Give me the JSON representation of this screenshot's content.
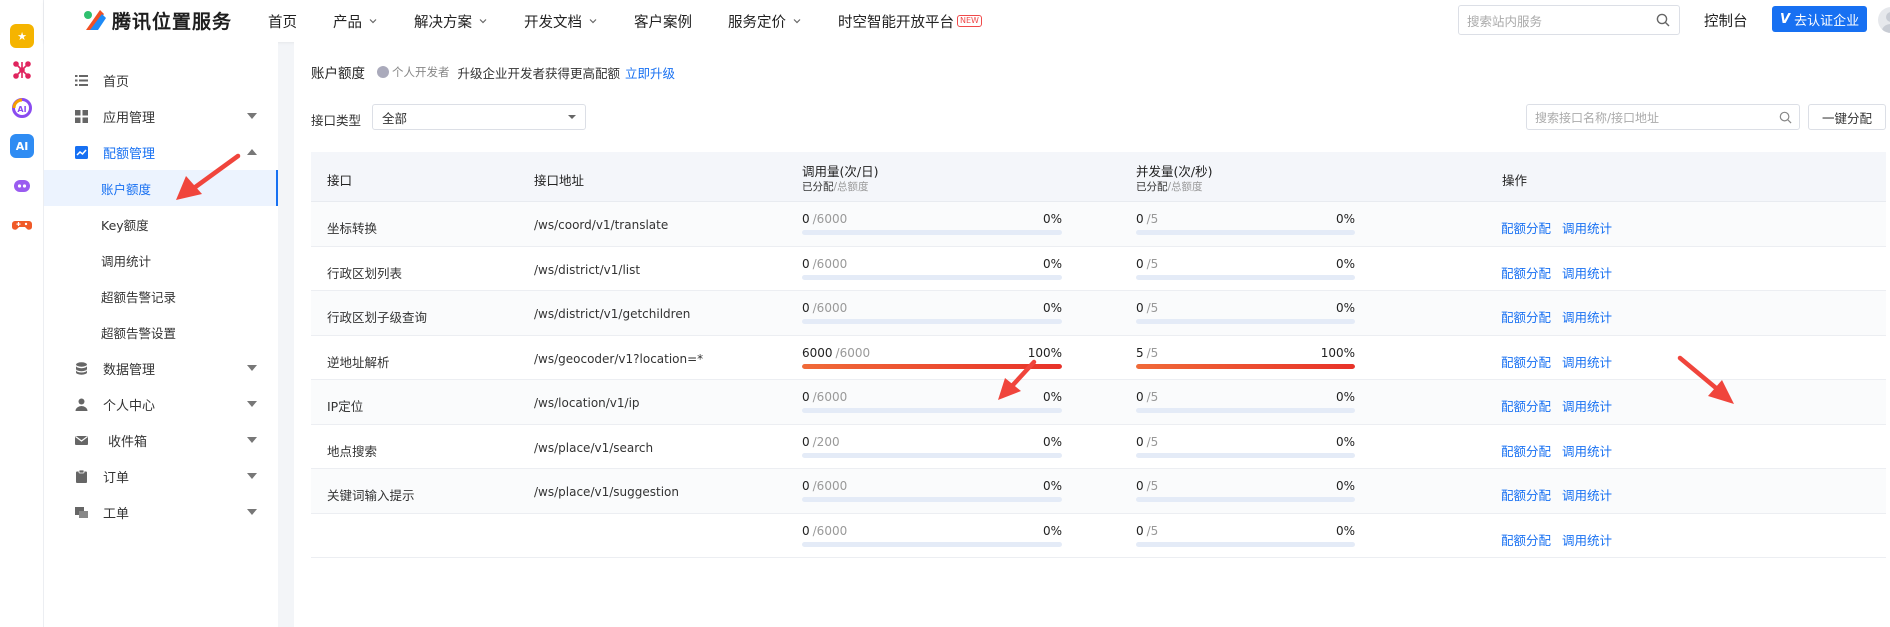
{
  "brand": {
    "name": "腾讯位置服务"
  },
  "nav": {
    "items": [
      {
        "label": "首页",
        "dropdown": false,
        "badge": ""
      },
      {
        "label": "产品",
        "dropdown": true,
        "badge": ""
      },
      {
        "label": "解决方案",
        "dropdown": true,
        "badge": ""
      },
      {
        "label": "开发文档",
        "dropdown": true,
        "badge": ""
      },
      {
        "label": "客户案例",
        "dropdown": false,
        "badge": ""
      },
      {
        "label": "服务定价",
        "dropdown": true,
        "badge": ""
      },
      {
        "label": "时空智能开放平台",
        "dropdown": false,
        "badge": "NEW"
      }
    ],
    "search_placeholder": "搜索站内服务",
    "console": "控制台",
    "cert_button": "去认证企业",
    "cert_mark": "V"
  },
  "sidebar": {
    "items": [
      {
        "label": "首页",
        "icon": "list-icon"
      },
      {
        "label": "应用管理",
        "icon": "grid-icon",
        "expanded": false
      },
      {
        "label": "配额管理",
        "icon": "chart-icon",
        "expanded": true,
        "active": true
      },
      {
        "label": "数据管理",
        "icon": "database-icon",
        "expanded": false
      },
      {
        "label": "个人中心",
        "icon": "user-icon",
        "expanded": false
      },
      {
        "label": "收件箱",
        "icon": "mail-icon",
        "expanded": false
      },
      {
        "label": "订单",
        "icon": "clipboard-icon",
        "expanded": false
      },
      {
        "label": "工单",
        "icon": "ticket-icon",
        "expanded": false
      }
    ],
    "sub_items": [
      {
        "label": "账户额度",
        "selected": true
      },
      {
        "label": "Key额度",
        "selected": false
      },
      {
        "label": "调用统计",
        "selected": false
      },
      {
        "label": "超额告警记录",
        "selected": false
      },
      {
        "label": "超额告警设置",
        "selected": false
      }
    ]
  },
  "page": {
    "title": "账户额度",
    "dev_type": "个人开发者",
    "upgrade_text": "升级企业开发者获得更高配额",
    "upgrade_link": "立即升级",
    "filter_label": "接口类型",
    "filter_value": "全部",
    "search_placeholder": "搜索接口名称/接口地址",
    "allot_all": "一键分配"
  },
  "table": {
    "headers": {
      "api": "接口",
      "address": "接口地址",
      "daily": "调用量(次/日)",
      "concurrency": "并发量(次/秒)",
      "sub_allocated": "已分配",
      "sub_total": "/总额度",
      "ops": "操作"
    },
    "op_labels": {
      "allocate": "配额分配",
      "stats": "调用统计"
    },
    "rows": [
      {
        "name": "坐标转换",
        "path": "/ws/coord/v1/translate",
        "daily_used": "0",
        "daily_total": "/6000",
        "daily_pct": "0%",
        "daily_ratio": 0,
        "conc_used": "0",
        "conc_total": "/5",
        "conc_pct": "0%",
        "conc_ratio": 0
      },
      {
        "name": "行政区划列表",
        "path": "/ws/district/v1/list",
        "daily_used": "0",
        "daily_total": "/6000",
        "daily_pct": "0%",
        "daily_ratio": 0,
        "conc_used": "0",
        "conc_total": "/5",
        "conc_pct": "0%",
        "conc_ratio": 0
      },
      {
        "name": "行政区划子级查询",
        "path": "/ws/district/v1/getchildren",
        "daily_used": "0",
        "daily_total": "/6000",
        "daily_pct": "0%",
        "daily_ratio": 0,
        "conc_used": "0",
        "conc_total": "/5",
        "conc_pct": "0%",
        "conc_ratio": 0
      },
      {
        "name": "逆地址解析",
        "path": "/ws/geocoder/v1?location=*",
        "daily_used": "6000",
        "daily_total": "/6000",
        "daily_pct": "100%",
        "daily_ratio": 1,
        "conc_used": "5",
        "conc_total": "/5",
        "conc_pct": "100%",
        "conc_ratio": 1
      },
      {
        "name": "IP定位",
        "path": "/ws/location/v1/ip",
        "daily_used": "0",
        "daily_total": "/6000",
        "daily_pct": "0%",
        "daily_ratio": 0,
        "conc_used": "0",
        "conc_total": "/5",
        "conc_pct": "0%",
        "conc_ratio": 0
      },
      {
        "name": "地点搜索",
        "path": "/ws/place/v1/search",
        "daily_used": "0",
        "daily_total": "/200",
        "daily_pct": "0%",
        "daily_ratio": 0,
        "conc_used": "0",
        "conc_total": "/5",
        "conc_pct": "0%",
        "conc_ratio": 0
      },
      {
        "name": "关键词输入提示",
        "path": "/ws/place/v1/suggestion",
        "daily_used": "0",
        "daily_total": "/6000",
        "daily_pct": "0%",
        "daily_ratio": 0,
        "conc_used": "0",
        "conc_total": "/5",
        "conc_pct": "0%",
        "conc_ratio": 0
      },
      {
        "name": "",
        "path": "",
        "daily_used": "0",
        "daily_total": "/6000",
        "daily_pct": "0%",
        "daily_ratio": 0,
        "conc_used": "0",
        "conc_total": "/5",
        "conc_pct": "0%",
        "conc_ratio": 0
      }
    ]
  },
  "colors": {
    "accent": "#1770f2",
    "bar_track": "#e4ebf7",
    "bar_full": "#e83229",
    "annotation": "#f0453c"
  }
}
